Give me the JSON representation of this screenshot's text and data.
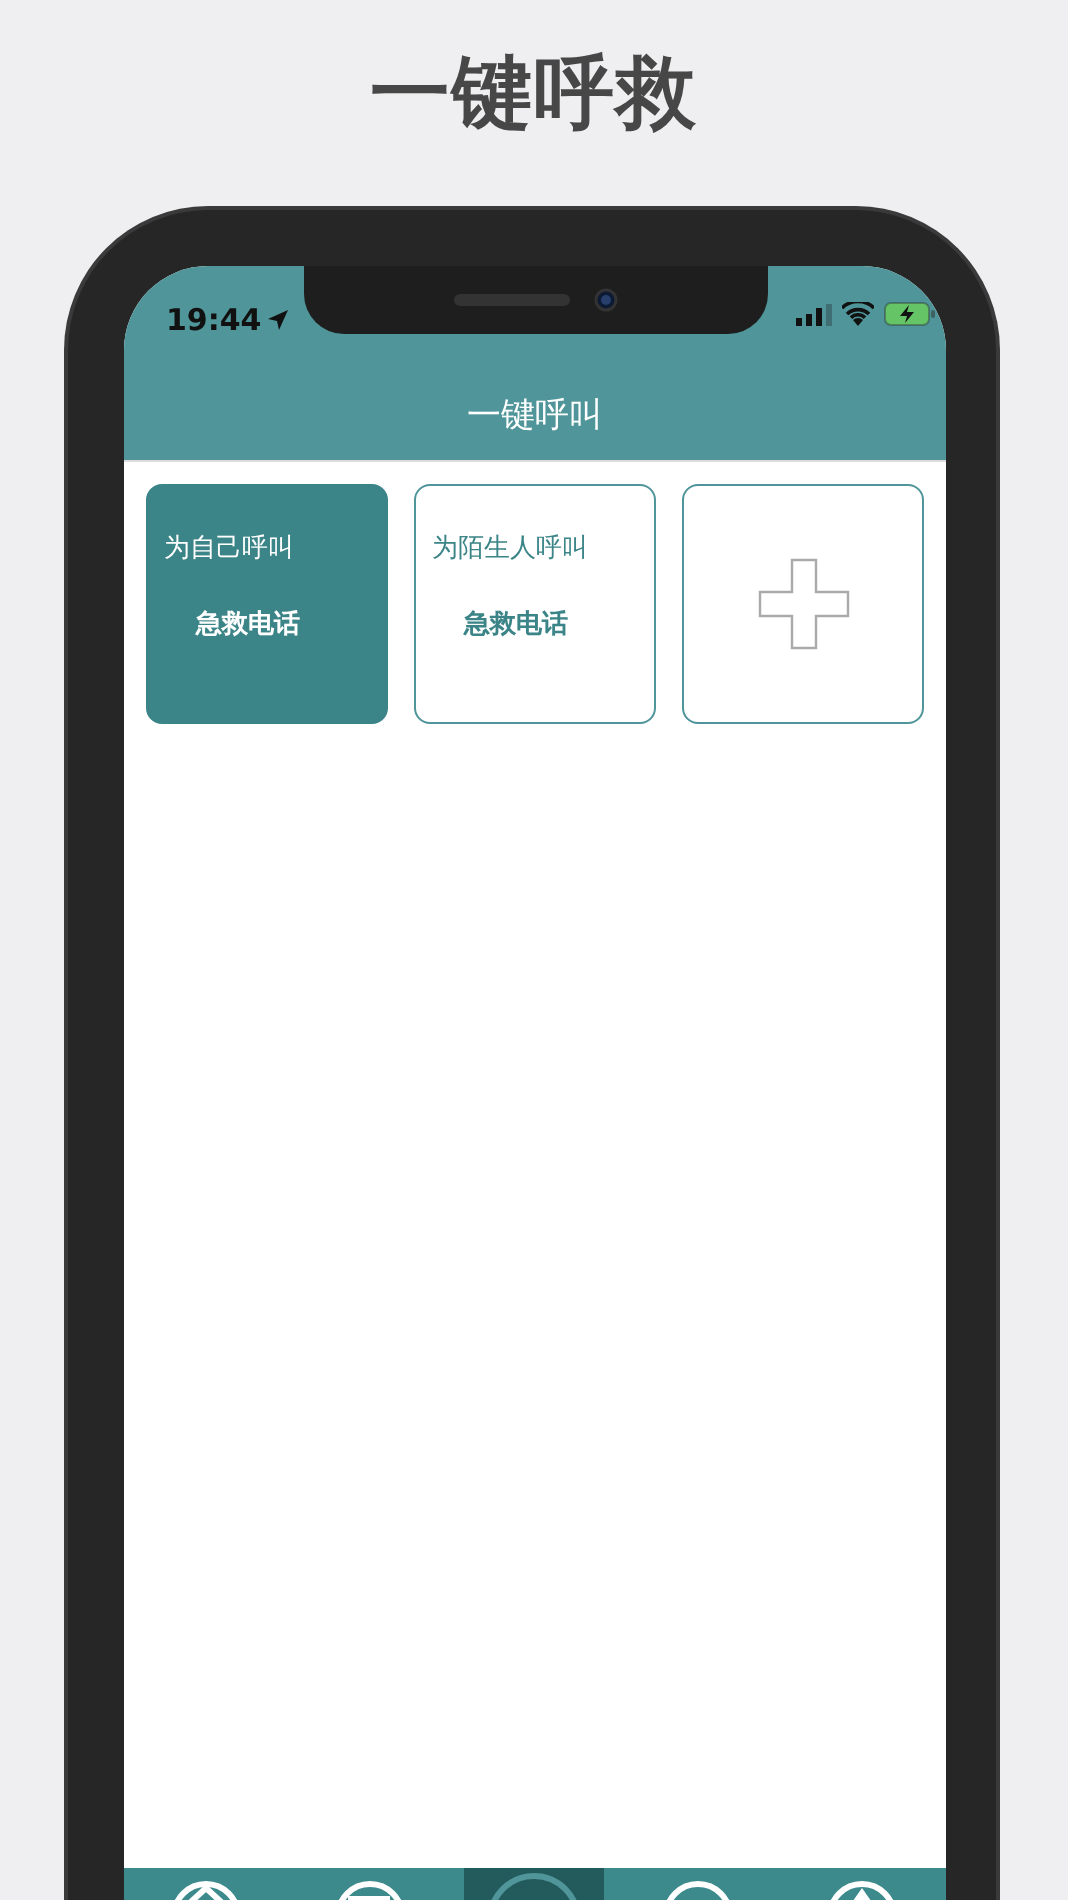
{
  "headline": "一键呼救",
  "status_bar": {
    "time": "19:44"
  },
  "nav": {
    "title": "一键呼叫"
  },
  "cards": [
    {
      "kind": "call",
      "title": "为自己呼叫",
      "subtitle": "急救电话",
      "selected": true
    },
    {
      "kind": "call",
      "title": "为陌生人呼叫",
      "subtitle": "急救电话",
      "selected": false
    },
    {
      "kind": "add"
    }
  ],
  "tabs": [
    {
      "selected": false
    },
    {
      "selected": false
    },
    {
      "selected": true
    },
    {
      "selected": false
    },
    {
      "selected": false
    }
  ]
}
